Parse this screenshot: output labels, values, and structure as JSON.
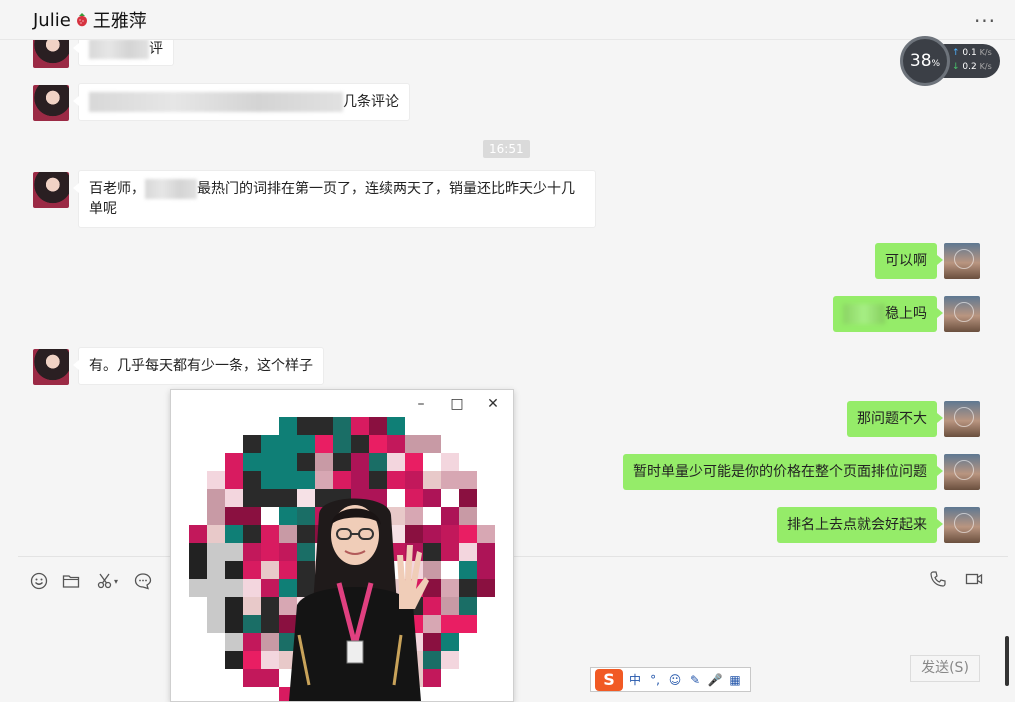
{
  "header": {
    "contact_name": "Julie",
    "contact_name_cn": "王雅萍",
    "more_label": "..."
  },
  "network_widget": {
    "percent": "38",
    "percent_unit": "%",
    "upload": "0.1",
    "download": "0.2",
    "unit": "K/s"
  },
  "messages": [
    {
      "side": "in",
      "text": "评"
    },
    {
      "side": "in",
      "text": "几条评论"
    },
    {
      "side": "in",
      "text_prefix": "百老师，",
      "text_suffix": "最热门的词排在第一页了，连续两天了，销量还比昨天少十几单呢"
    },
    {
      "side": "out",
      "text": "可以啊"
    },
    {
      "side": "out",
      "text": "稳上吗"
    },
    {
      "side": "in",
      "text": "有。几乎每天都有少一条，这个样子"
    },
    {
      "side": "out",
      "text": "那问题不大"
    },
    {
      "side": "out",
      "text": "暂时单量少可能是你的价格在整个页面排位问题"
    },
    {
      "side": "out",
      "text": "排名上去点就会好起来"
    }
  ],
  "timestamp": "16:51",
  "toolbar": {
    "emoji_icon": "smiley-icon",
    "file_icon": "folder-icon",
    "screenshot_icon": "scissors-icon",
    "chat_history_icon": "chat-bubble-icon",
    "voice_call_icon": "phone-icon",
    "video_call_icon": "video-icon"
  },
  "send_button": "发送(S)",
  "image_viewer": {
    "minimize": "–",
    "maximize": "□",
    "close": "✕"
  },
  "ime": {
    "logo": "S",
    "mode": "中",
    "punct": "°,",
    "items": [
      "☺",
      "✎",
      "🎤",
      "▦"
    ]
  },
  "colors": {
    "background": "#f5f5f5",
    "bubble_out": "#95ec69",
    "bubble_in": "#ffffff",
    "timestamp_bg": "#dadada"
  }
}
